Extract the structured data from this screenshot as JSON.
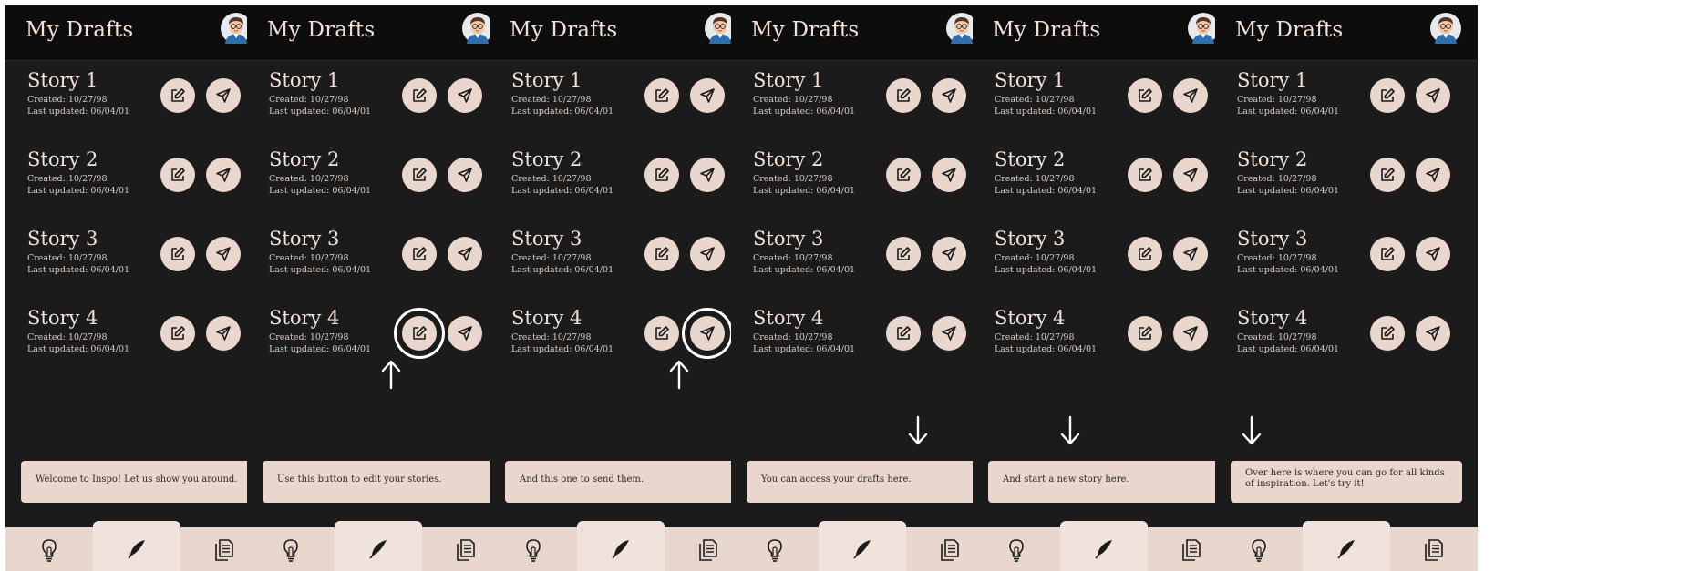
{
  "header": {
    "title": "My Drafts",
    "avatar_icon": "user-avatar-icon"
  },
  "stories": [
    {
      "name": "Story 1",
      "created": "Created: 10/27/98",
      "updated": "Last updated: 06/04/01"
    },
    {
      "name": "Story 2",
      "created": "Created: 10/27/98",
      "updated": "Last updated: 06/04/01"
    },
    {
      "name": "Story 3",
      "created": "Created: 10/27/98",
      "updated": "Last updated: 06/04/01"
    },
    {
      "name": "Story 4",
      "created": "Created: 10/27/98",
      "updated": "Last updated: 06/04/01"
    }
  ],
  "screens": [
    {
      "tip": "Welcome to Inspo! Let us show you around.",
      "highlight": "none",
      "arrow": "none"
    },
    {
      "tip": "Use this button to edit your stories.",
      "highlight": "edit",
      "arrow": "up-edit"
    },
    {
      "tip": "And this one to send them.",
      "highlight": "send",
      "arrow": "up-send"
    },
    {
      "tip": "You can access your drafts here.",
      "highlight": "none",
      "arrow": "down-drafts"
    },
    {
      "tip": "And start a new story here.",
      "highlight": "none",
      "arrow": "down-write"
    },
    {
      "tip": "Over here is where you can go for all kinds of inspiration. Let's try it!",
      "highlight": "none",
      "arrow": "down-inspiration"
    }
  ],
  "tabs": [
    {
      "name": "inspiration-tab",
      "icon": "lightbulb-icon"
    },
    {
      "name": "write-tab",
      "icon": "quill-icon",
      "active": true
    },
    {
      "name": "drafts-tab",
      "icon": "documents-icon"
    }
  ],
  "colors": {
    "background": "#1b1b1b",
    "header": "#0d0d0d",
    "accent": "#e9d6cc",
    "text": "#f1e2d8"
  }
}
